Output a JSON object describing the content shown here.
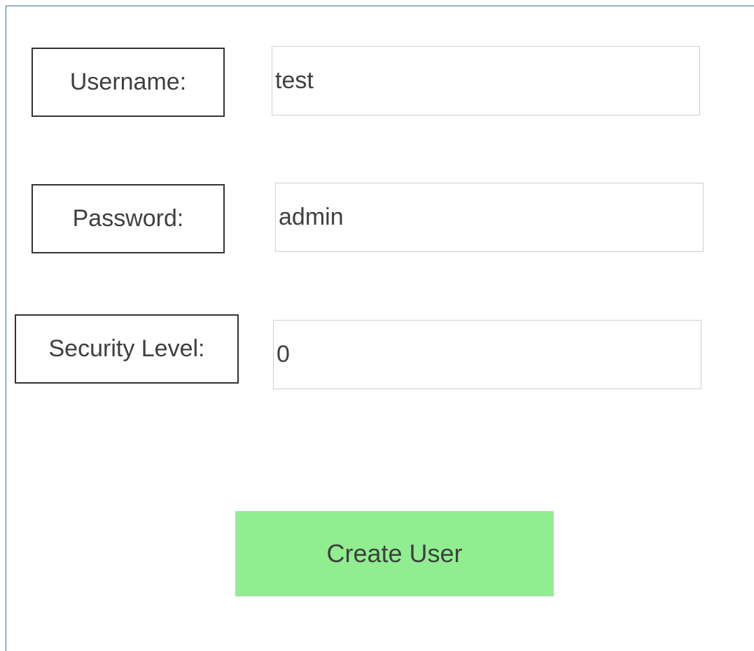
{
  "form": {
    "username": {
      "label": "Username:",
      "value": "test"
    },
    "password": {
      "label": "Password:",
      "value": "admin"
    },
    "security_level": {
      "label": "Security Level:",
      "value": "0"
    },
    "submit_label": "Create User"
  },
  "colors": {
    "button_background": "#90ee90",
    "label_border": "#333333",
    "field_border": "#cfcfcf",
    "frame_border": "#3a6ea5"
  }
}
